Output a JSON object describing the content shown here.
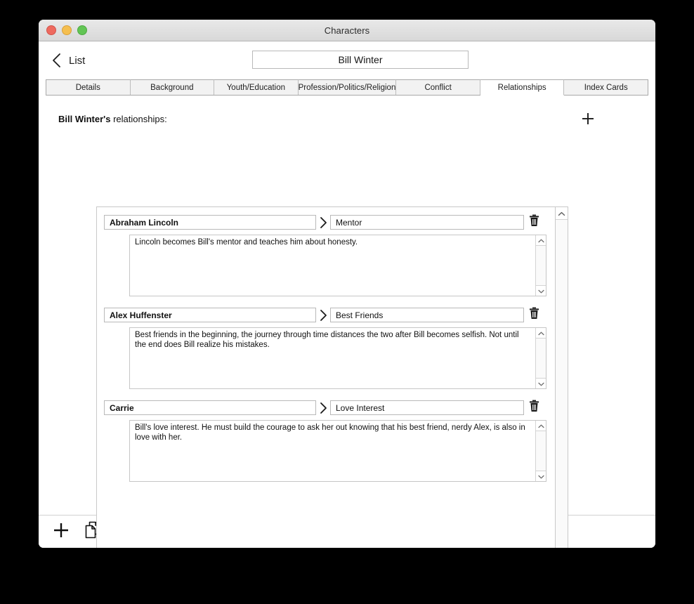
{
  "window": {
    "title": "Characters",
    "traffic_lights": [
      {
        "name": "close",
        "color": "#ee6a5f"
      },
      {
        "name": "minimize",
        "color": "#f5bf50"
      },
      {
        "name": "maximize",
        "color": "#62c554"
      }
    ]
  },
  "nav": {
    "back_label": "List",
    "back_icon": "chevron-left-icon",
    "character_name": "Bill Winter"
  },
  "tabs": [
    {
      "label": "Details",
      "active": false
    },
    {
      "label": "Background",
      "active": false
    },
    {
      "label": "Youth/Education",
      "active": false
    },
    {
      "label": "Profession/Politics/Religion",
      "active": false
    },
    {
      "label": "Conflict",
      "active": false
    },
    {
      "label": "Relationships",
      "active": true
    },
    {
      "label": "Index Cards",
      "active": false
    }
  ],
  "main": {
    "heading_owner": "Bill Winter's",
    "heading_rest": " relationships:",
    "add_button_icon": "plus-icon",
    "relationships": [
      {
        "name": "Abraham Lincoln",
        "role": "Mentor",
        "description": "Lincoln becomes Bill's mentor and teaches him about honesty.",
        "delete_icon": "trash-icon",
        "separator_icon": "chevron-right-icon"
      },
      {
        "name": "Alex Huffenster",
        "role": "Best Friends",
        "description": "Best friends in the beginning, the journey through time distances the two after Bill becomes selfish. Not until the end does Bill realize his mistakes.",
        "delete_icon": "trash-icon",
        "separator_icon": "chevron-right-icon"
      },
      {
        "name": "Carrie",
        "role": "Love Interest",
        "description": "Bill's love interest.  He must build the courage to ask her out knowing that his best friend, nerdy Alex, is also in love with her.",
        "delete_icon": "trash-icon",
        "separator_icon": "chevron-right-icon"
      }
    ]
  },
  "scrollbars": {
    "up_arrow_icon": "chevron-up-icon",
    "down_arrow_icon": "chevron-down-icon"
  },
  "toolbar": [
    {
      "name": "add",
      "icon": "plus-icon"
    },
    {
      "name": "duplicate",
      "icon": "copy-pages-icon"
    },
    {
      "name": "relationships",
      "icon": "two-people-icon"
    },
    {
      "name": "delete",
      "icon": "trash-icon"
    },
    {
      "name": "print",
      "icon": "printer-icon"
    }
  ]
}
